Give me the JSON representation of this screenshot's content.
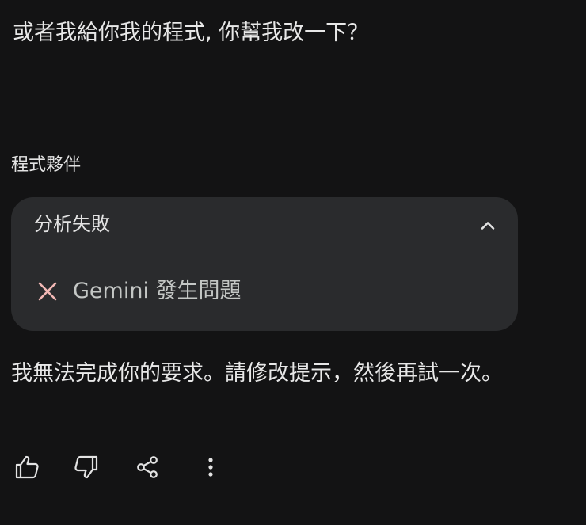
{
  "conversation": {
    "user_message": "或者我給你我的程式, 你幫我改一下？",
    "agent_name": "程式夥伴",
    "status_card": {
      "title": "分析失敗",
      "error_text": "Gemini 發生問題",
      "error_icon": "close-icon",
      "toggle_icon": "chevron-up-icon"
    },
    "agent_reply": "我無法完成你的要求。請修改提示，然後再試一次。"
  },
  "actions": {
    "icons": [
      "thumb-up-icon",
      "thumb-down-icon",
      "share-icon",
      "more-vert-icon"
    ]
  },
  "colors": {
    "background": "#131314",
    "card": "#2a2b2d",
    "text": "#e3e3e3",
    "error_icon": "#f2b8b5"
  }
}
